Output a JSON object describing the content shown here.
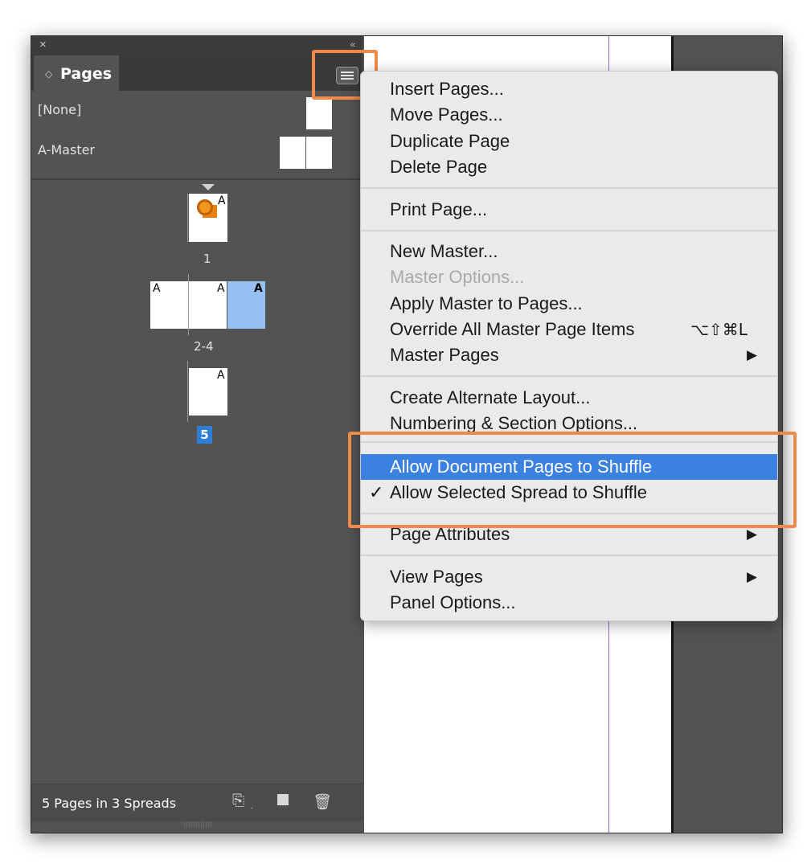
{
  "panel": {
    "close_glyph": "×",
    "collapse_glyph": "‹‹",
    "tab_chevron": "◇",
    "tab_title": "Pages",
    "masters": [
      {
        "label": "[None]"
      },
      {
        "label": "A-Master"
      }
    ],
    "spreads": [
      {
        "label": "1",
        "pages": [
          "A"
        ]
      },
      {
        "label": "2-4",
        "pages": [
          "A",
          "A",
          "A"
        ]
      },
      {
        "label": "5",
        "pages": [
          "A"
        ]
      }
    ],
    "footer_text": "5 Pages in 3 Spreads",
    "footer_icons": [
      "edit-page-size-icon",
      "new-page-icon",
      "trash-icon"
    ]
  },
  "menu": {
    "items": [
      {
        "label": "Insert Pages..."
      },
      {
        "label": "Move Pages..."
      },
      {
        "label": "Duplicate Page"
      },
      {
        "label": "Delete Page"
      },
      {
        "label": "Print Page..."
      },
      {
        "label": "New Master..."
      },
      {
        "label": "Master Options...",
        "disabled": true
      },
      {
        "label": "Apply Master to Pages..."
      },
      {
        "label": "Override All Master Page Items",
        "shortcut": "⌥⇧⌘L"
      },
      {
        "label": "Master Pages",
        "submenu": true
      },
      {
        "label": "Create Alternate Layout..."
      },
      {
        "label": "Numbering & Section Options..."
      },
      {
        "label": "Allow Document Pages to Shuffle",
        "highlighted": true
      },
      {
        "label": "Allow Selected Spread to Shuffle",
        "checked": true
      },
      {
        "label": "Page Attributes",
        "submenu": true
      },
      {
        "label": "View Pages",
        "submenu": true
      },
      {
        "label": "Panel Options..."
      }
    ],
    "check_glyph": "✓",
    "submenu_glyph": "▶"
  },
  "colors": {
    "highlight": "#3b82e0",
    "callout": "#f08a4b",
    "selected_page": "#96c1f2",
    "panel_bg": "#535353"
  }
}
